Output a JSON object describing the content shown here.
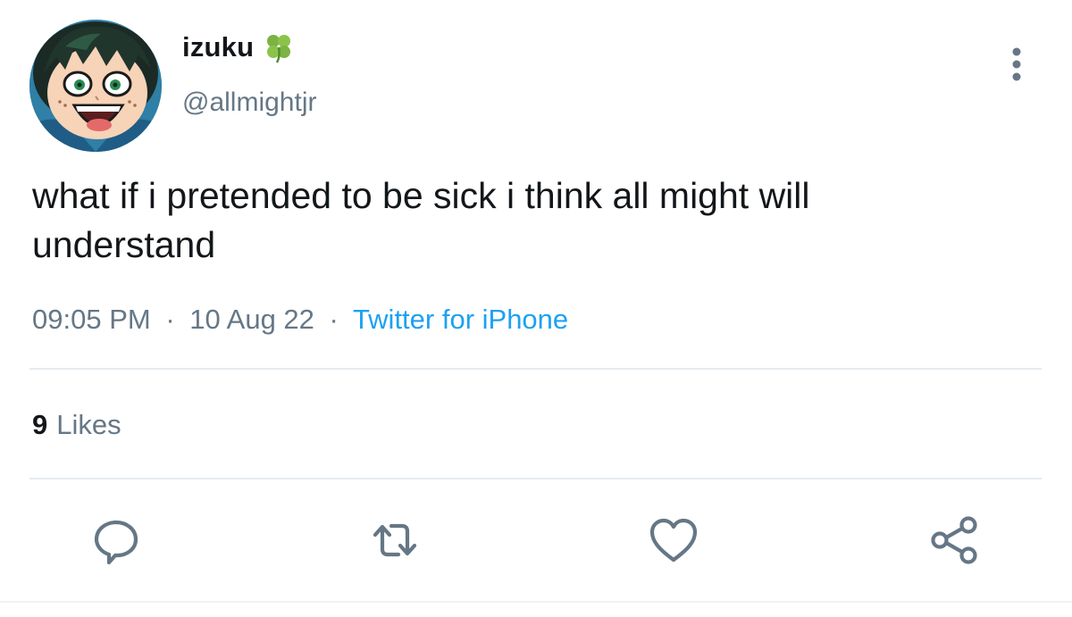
{
  "author": {
    "display_name": "izuku",
    "name_emoji_icon": "four-leaf-clover-icon",
    "handle": "@allmightjr"
  },
  "tweet": {
    "text_line_1": "what if i pretended to be sick i think all might will",
    "text_line_2": "understand"
  },
  "meta": {
    "time": "09:05 PM",
    "separator": "·",
    "date": "10 Aug 22",
    "source": "Twitter for iPhone"
  },
  "stats": {
    "likes_count": "9",
    "likes_label": "Likes"
  },
  "actions": [
    "reply-icon",
    "retweet-icon",
    "like-icon",
    "share-icon"
  ],
  "colors": {
    "text_primary": "#14171a",
    "text_secondary": "#657786",
    "link": "#1da1f2",
    "divider": "#e6ecf0"
  }
}
